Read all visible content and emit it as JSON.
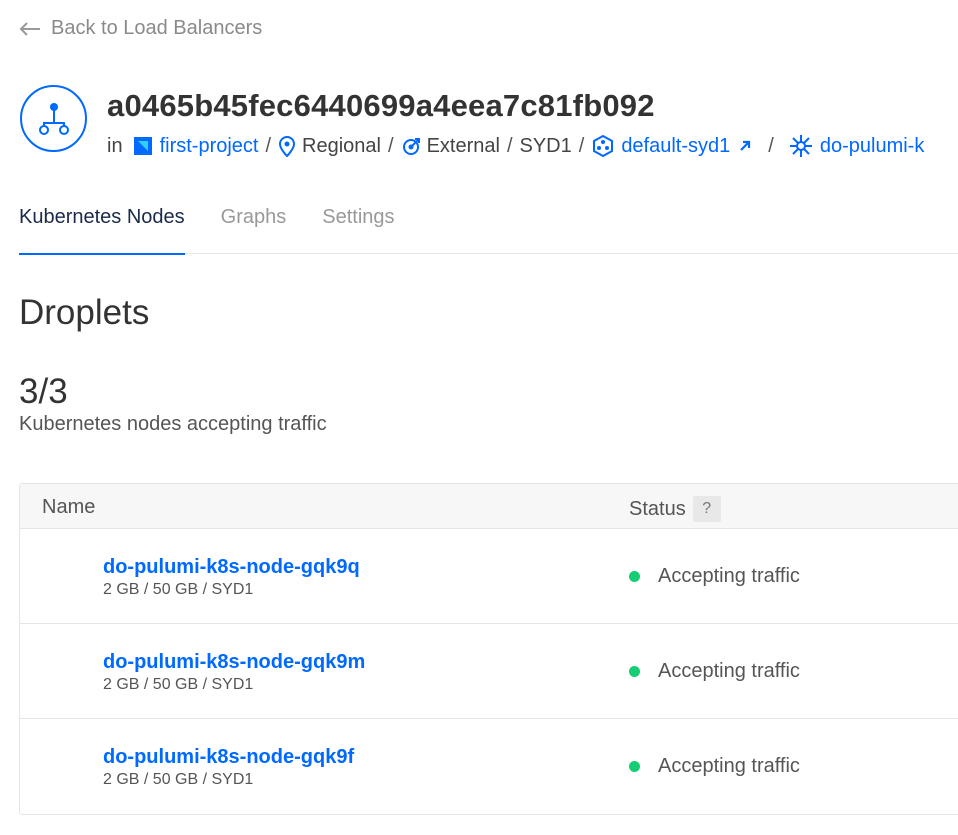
{
  "nav": {
    "back_label": "Back to Load Balancers"
  },
  "header": {
    "title": "a0465b45fec6440699a4eea7c81fb092",
    "in_label": "in",
    "project": "first-project",
    "scope": "Regional",
    "network": "External",
    "region": "SYD1",
    "vpc": "default-syd1",
    "cluster": "do-pulumi-k",
    "separator": "/"
  },
  "tabs": [
    {
      "label": "Kubernetes Nodes",
      "active": true
    },
    {
      "label": "Graphs",
      "active": false
    },
    {
      "label": "Settings",
      "active": false
    }
  ],
  "section": {
    "title": "Droplets",
    "count": "3/3",
    "count_label": "Kubernetes nodes accepting traffic"
  },
  "table": {
    "columns": {
      "name": "Name",
      "status": "Status",
      "help": "?"
    },
    "rows": [
      {
        "name": "do-pulumi-k8s-node-gqk9q",
        "spec": "2 GB / 50 GB / SYD1",
        "status": "Accepting traffic"
      },
      {
        "name": "do-pulumi-k8s-node-gqk9m",
        "spec": "2 GB / 50 GB / SYD1",
        "status": "Accepting traffic"
      },
      {
        "name": "do-pulumi-k8s-node-gqk9f",
        "spec": "2 GB / 50 GB / SYD1",
        "status": "Accepting traffic"
      }
    ]
  },
  "colors": {
    "accent": "#0069ff",
    "status_ok": "#15cd72"
  },
  "icons": {
    "back": "arrow-left-icon",
    "load_balancer": "load-balancer-icon",
    "project": "project-icon",
    "region": "location-pin-icon",
    "network": "external-network-icon",
    "vpc": "vpc-icon",
    "external_link": "external-link-icon",
    "cluster": "kubernetes-cluster-icon"
  }
}
